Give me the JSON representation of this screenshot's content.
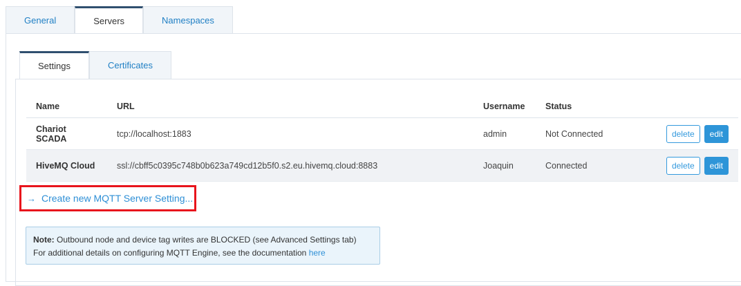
{
  "outer_tabs": [
    {
      "label": "General"
    },
    {
      "label": "Servers"
    },
    {
      "label": "Namespaces"
    }
  ],
  "inner_tabs": [
    {
      "label": "Settings"
    },
    {
      "label": "Certificates"
    }
  ],
  "table": {
    "headers": {
      "name": "Name",
      "url": "URL",
      "username": "Username",
      "status": "Status"
    },
    "rows": [
      {
        "name": "Chariot SCADA",
        "url": "tcp://localhost:1883",
        "username": "admin",
        "status": "Not Connected",
        "delete": "delete",
        "edit": "edit"
      },
      {
        "name": "HiveMQ Cloud",
        "url": "ssl://cbff5c0395c748b0b623a749cd12b5f0.s2.eu.hivemq.cloud:8883",
        "username": "Joaquin",
        "status": "Connected",
        "delete": "delete",
        "edit": "edit"
      }
    ]
  },
  "create_link": {
    "arrow": "→",
    "label": "Create new MQTT Server Setting..."
  },
  "note": {
    "prefix": "Note:",
    "line1": " Outbound node and device tag writes are BLOCKED (see Advanced Settings tab)",
    "line2": "For additional details on configuring MQTT Engine, see the documentation ",
    "link": "here"
  },
  "colors": {
    "accent": "#2e95d8",
    "highlight": "#e8141c"
  }
}
